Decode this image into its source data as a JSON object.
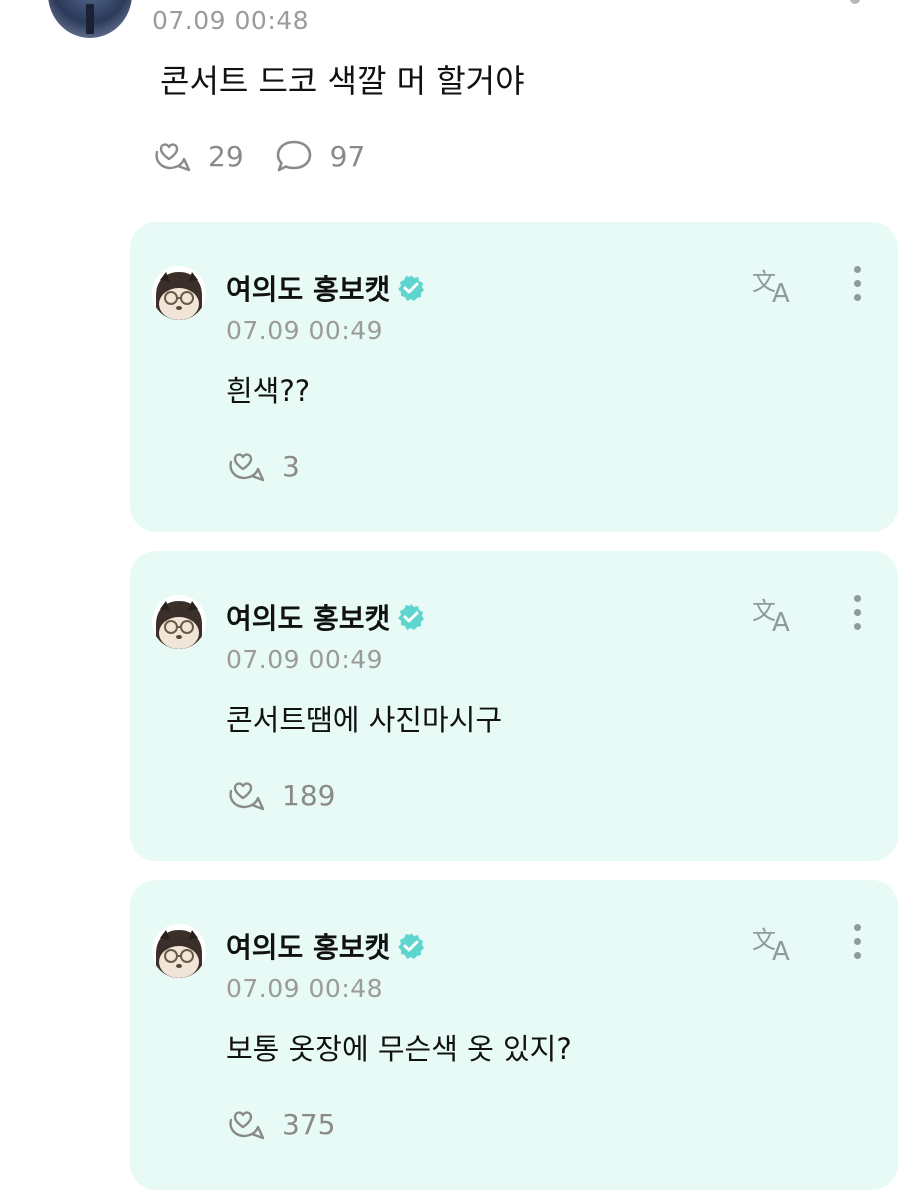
{
  "post": {
    "time": "07.09 00:48",
    "text": "콘서트 드코 색깔 머 할거야",
    "like_count": "29",
    "comment_count": "97"
  },
  "replies": [
    {
      "author": "여의도 홍보캣",
      "time": "07.09 00:49",
      "text": "흰색??",
      "like_count": "3"
    },
    {
      "author": "여의도 홍보캣",
      "time": "07.09 00:49",
      "text": "콘서트땜에 사진마시구",
      "like_count": "189"
    },
    {
      "author": "여의도 홍보캣",
      "time": "07.09 00:48",
      "text": "보통 옷장에 무슨색 옷 있지?",
      "like_count": "375"
    }
  ],
  "icons": {
    "like": "heart-bubble-icon",
    "comment": "comment-bubble-icon",
    "translate": "translate-icon",
    "more": "kebab-menu-icon",
    "verified": "verified-badge-icon"
  },
  "colors": {
    "card_background": "#e7faf6",
    "verified_badge": "#5fd5cf",
    "meta_text": "#9b9b9b"
  }
}
